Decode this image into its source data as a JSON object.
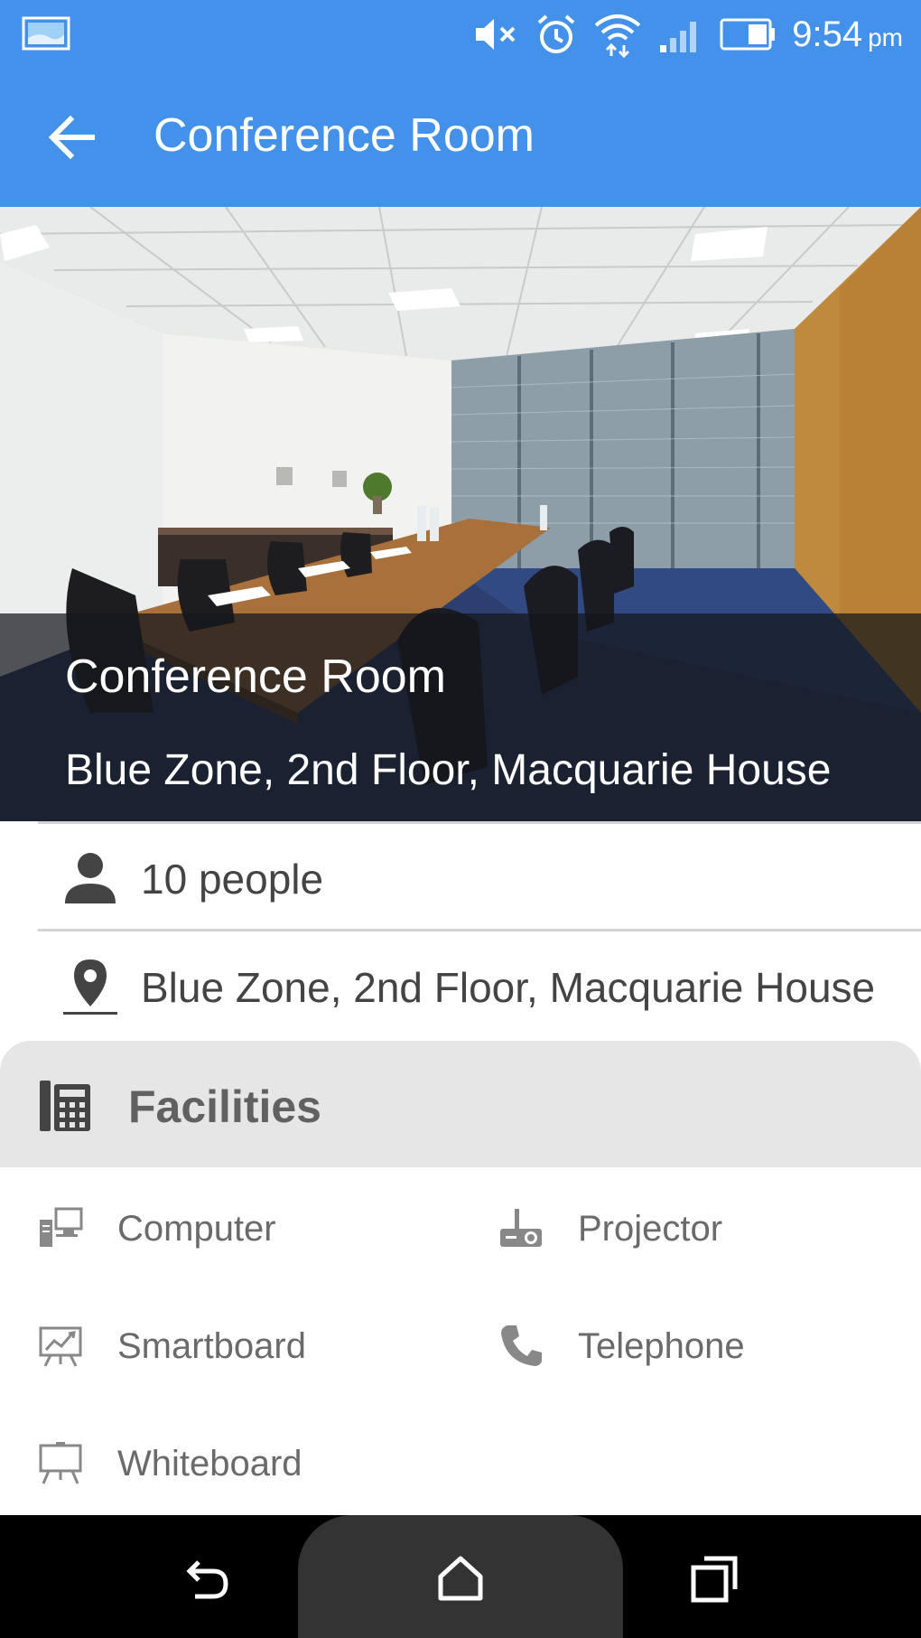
{
  "status_bar": {
    "time": "9:54",
    "ampm": "pm",
    "icons": [
      "gallery-icon",
      "mute-icon",
      "alarm-icon",
      "wifi-icon",
      "signal-icon",
      "battery-icon"
    ]
  },
  "app_bar": {
    "title": "Conference Room",
    "back_icon": "arrow-left-icon"
  },
  "hero": {
    "title": "Conference Room",
    "subtitle": "Blue Zone, 2nd Floor, Macquarie House"
  },
  "details": {
    "capacity": "10 people",
    "location": "Blue Zone, 2nd Floor, Macquarie House"
  },
  "facilities": {
    "heading": "Facilities",
    "items": [
      {
        "label": "Computer",
        "icon": "computer-icon"
      },
      {
        "label": "Projector",
        "icon": "projector-icon"
      },
      {
        "label": "Smartboard",
        "icon": "smartboard-icon"
      },
      {
        "label": "Telephone",
        "icon": "telephone-icon"
      },
      {
        "label": "Whiteboard",
        "icon": "whiteboard-icon"
      }
    ]
  },
  "colors": {
    "primary": "#4391e8",
    "facilities_bg": "#e6e6e6",
    "text_dark": "#444444",
    "text_muted": "#6a6a6a"
  }
}
